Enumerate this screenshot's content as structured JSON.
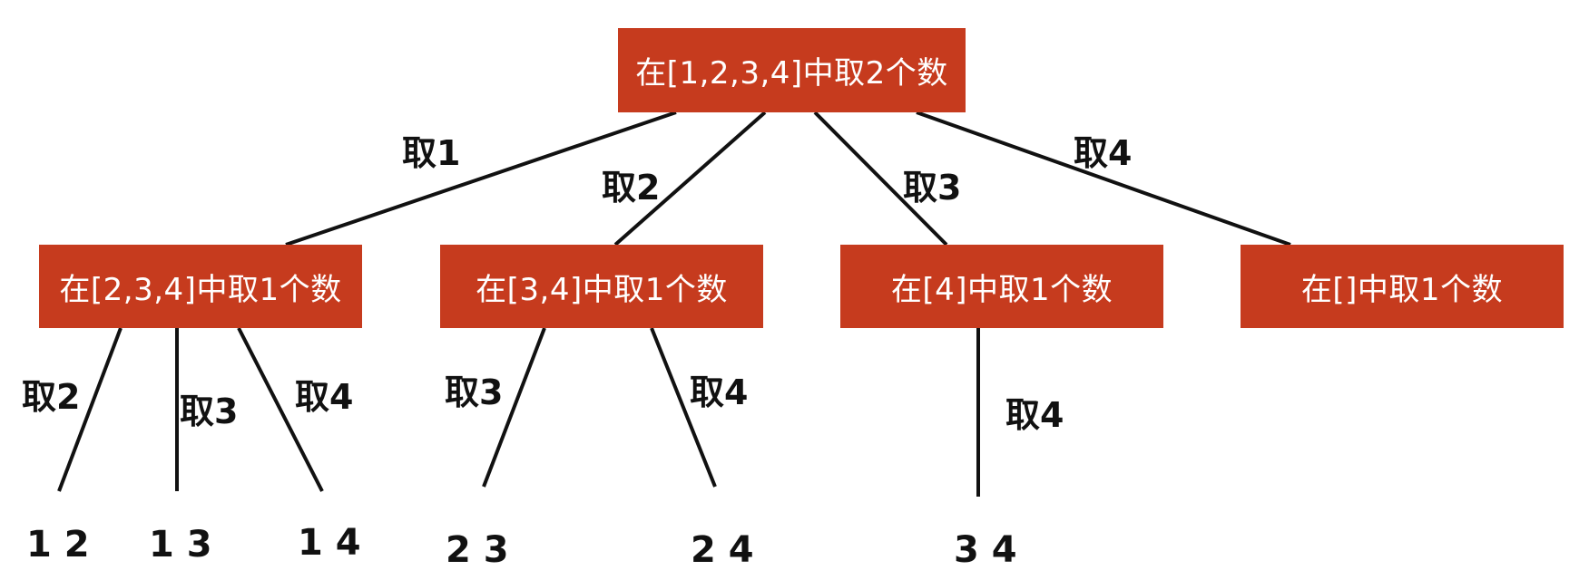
{
  "colors": {
    "node_fill": "#c63b1e",
    "node_text": "#ffffff",
    "edge": "#111111",
    "label": "#111111"
  },
  "root": {
    "label": "在[1,2,3,4]中取2个数"
  },
  "level1": [
    {
      "label": "在[2,3,4]中取1个数",
      "edge_label": "取1"
    },
    {
      "label": "在[3,4]中取1个数",
      "edge_label": "取2"
    },
    {
      "label": "在[4]中取1个数",
      "edge_label": "取3"
    },
    {
      "label": "在[]中取1个数",
      "edge_label": "取4"
    }
  ],
  "leaves": [
    {
      "label": "1 2",
      "edge_label": "取2"
    },
    {
      "label": "1 3",
      "edge_label": "取3"
    },
    {
      "label": "1 4",
      "edge_label": "取4"
    },
    {
      "label": "2 3",
      "edge_label": "取3"
    },
    {
      "label": "2 4",
      "edge_label": "取4"
    },
    {
      "label": "3 4",
      "edge_label": "取4"
    }
  ]
}
